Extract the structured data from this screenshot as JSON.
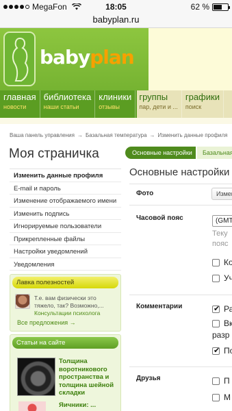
{
  "status": {
    "carrier": "MegaFon",
    "time": "18:05",
    "battery": "62 %",
    "battery_level": 0.62
  },
  "url": "babyplan.ru",
  "logo": {
    "part1": "baby",
    "part2": "plan"
  },
  "nav": [
    {
      "title": "главная",
      "sub": "новости"
    },
    {
      "title": "библиотека",
      "sub": "наши статьи"
    },
    {
      "title": "клиники",
      "sub": "отзывы"
    },
    {
      "title": "группы",
      "sub": "пар, дети и ..."
    },
    {
      "title": "графики",
      "sub": "поиск"
    }
  ],
  "breadcrumb": [
    "Ваша панель управления",
    "Базальная температура",
    "Изменить данные профиля"
  ],
  "breadcrumb_sep": "→",
  "page_title": "Моя страничка",
  "menu": [
    "Изменить данные профиля",
    "E-mail и пароль",
    "Изменение отображаемого имени",
    "Изменить подпись",
    "Игнорируемые пользователи",
    "Прикрепленные файлы",
    "Настройки уведомлений",
    "Уведомления"
  ],
  "promo": {
    "title": "Лавка полезностей",
    "text": "Т.е. вам физически это тяжело, так? Возможно,...",
    "link": "Консультации психолога",
    "more": "Все предложения →"
  },
  "articles": {
    "title": "Статьи на сайте",
    "item1": "Толщина воротникового пространства и толщина шейной складки",
    "item2": "Яичники: ..."
  },
  "tabs": {
    "active": "Основные настройки",
    "next": "Базальная"
  },
  "settings": {
    "title": "Основные настройки",
    "photo_label": "Фото",
    "photo_button": "Измен",
    "tz_label": "Часовой пояс",
    "tz_value": "(GMT",
    "tz_help": "Теку\nпояс",
    "tz_opt1": "Ко",
    "tz_opt2": "Уч",
    "comments_label": "Комментарии",
    "c_opt1": "Ра",
    "c_opt2": "Вк",
    "c_opt2b": "разр",
    "c_opt3": "По",
    "friends_label": "Друзья",
    "f_opt1": "П",
    "f_opt2": "М"
  }
}
